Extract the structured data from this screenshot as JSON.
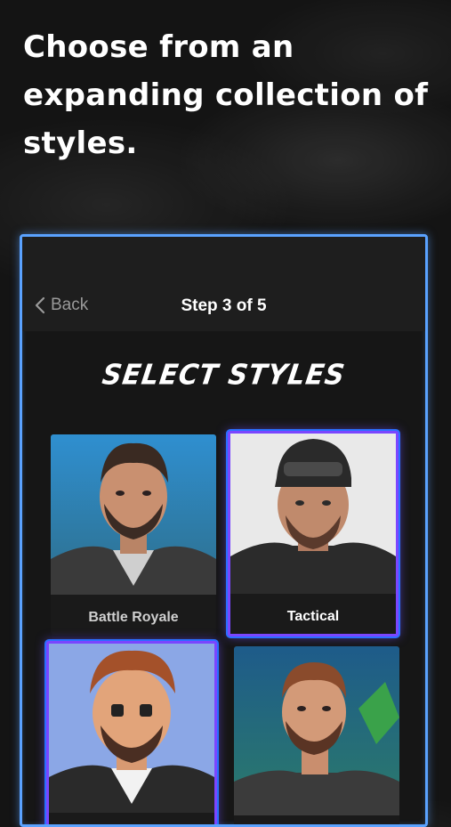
{
  "headline": "Choose from an expanding collection of styles.",
  "nav": {
    "back_label": "Back",
    "step_label": "Step 3 of 5"
  },
  "brand_title": "SELECT STYLES",
  "styles": [
    {
      "label": "Battle Royale",
      "selected": false
    },
    {
      "label": "Tactical",
      "selected": true
    },
    {
      "label": "",
      "selected": true
    },
    {
      "label": "",
      "selected": false
    }
  ],
  "colors": {
    "accent_blue": "#5aa2ff",
    "selected_purple": "#7a46ff",
    "background": "#141414"
  },
  "icons": {
    "back": "chevron-left-icon"
  }
}
